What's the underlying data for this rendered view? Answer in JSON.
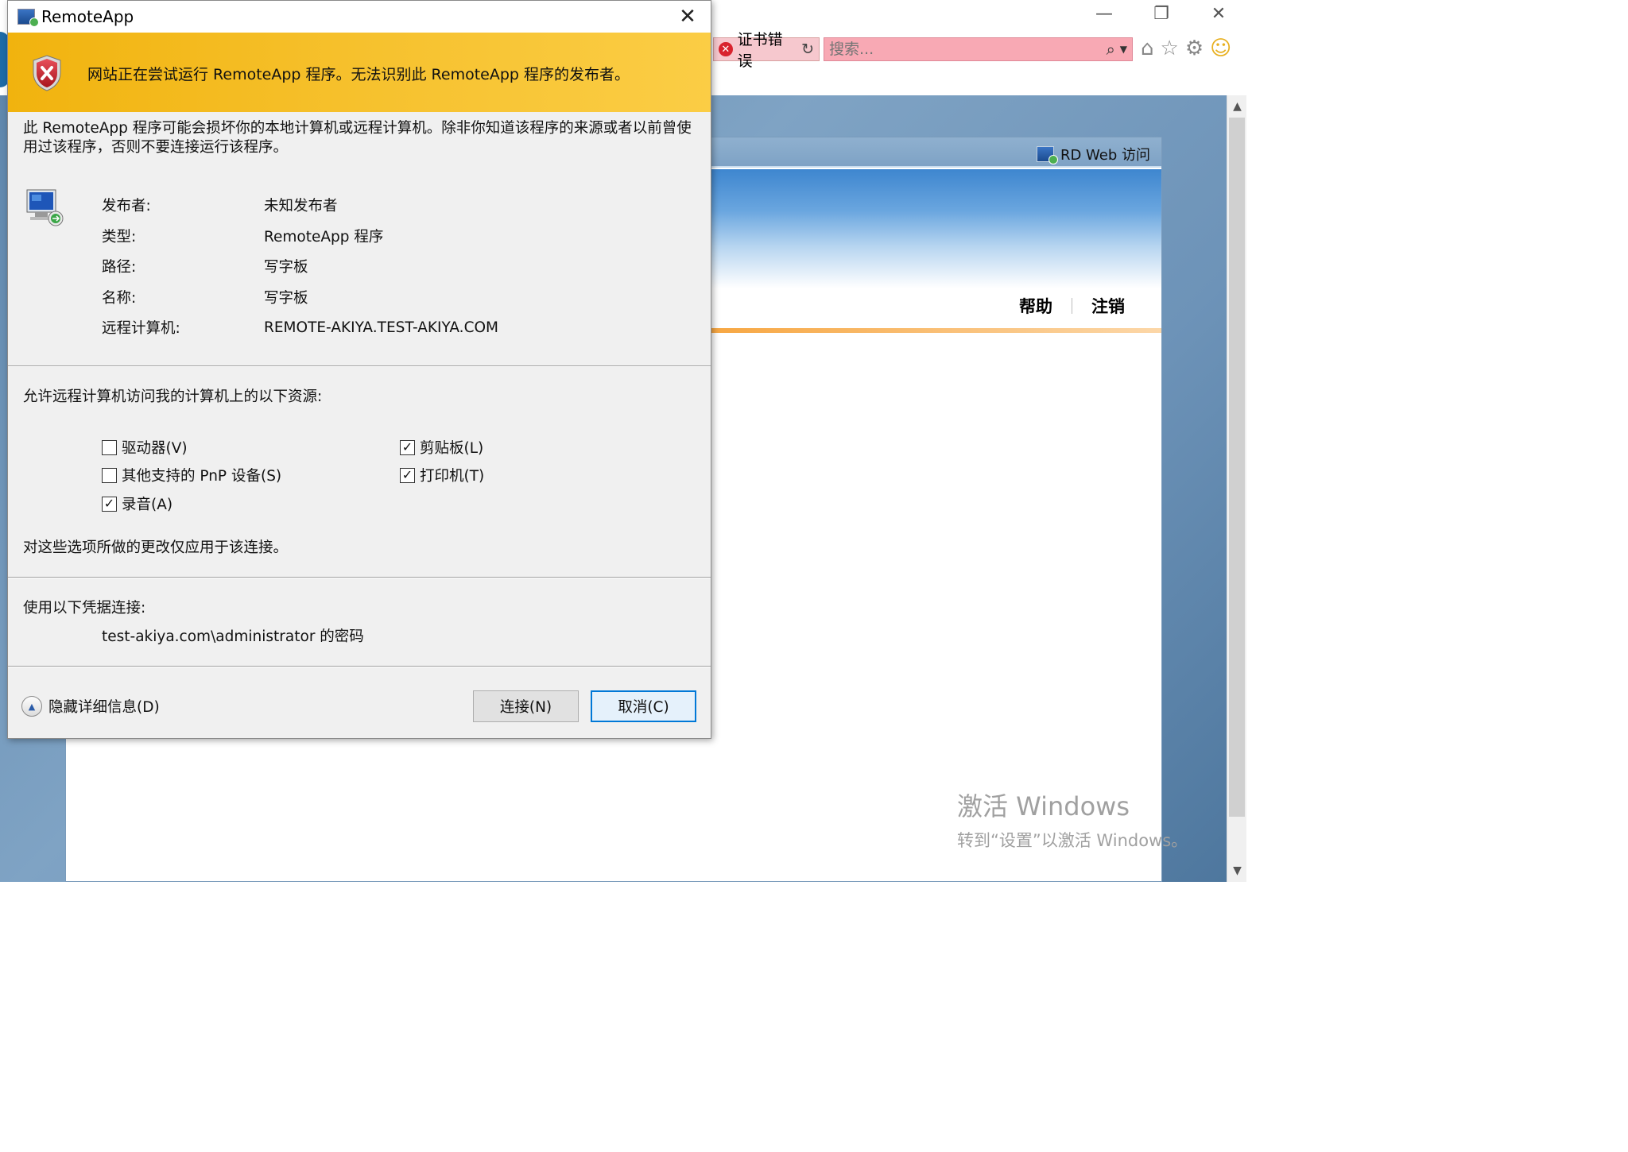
{
  "browser": {
    "window_controls": {
      "minimize": "—",
      "restore": "❐",
      "close": "✕"
    },
    "cert_error": "证书错误",
    "search": {
      "placeholder": "搜索..."
    },
    "toolbar_icons": [
      "home-icon",
      "favorites-star-icon",
      "gear-icon",
      "smiley-icon"
    ]
  },
  "rdweb": {
    "title": "RD Web 访问",
    "nav": {
      "help": "帮助",
      "logout": "注销"
    }
  },
  "watermark": {
    "line1": "激活 Windows",
    "line2": "转到“设置”以激活 Windows。"
  },
  "dialog": {
    "title": "RemoteApp",
    "warning": "网站正在尝试运行 RemoteApp 程序。无法识别此 RemoteApp 程序的发布者。",
    "intro": "此 RemoteApp 程序可能会损坏你的本地计算机或远程计算机。除非你知道该程序的来源或者以前曾使用过该程序，否则不要连接运行该程序。",
    "info": [
      {
        "label": "发布者:",
        "value": "未知发布者"
      },
      {
        "label": "类型:",
        "value": "RemoteApp 程序"
      },
      {
        "label": "路径:",
        "value": "写字板"
      },
      {
        "label": "名称:",
        "value": "写字板"
      },
      {
        "label": "远程计算机:",
        "value": "REMOTE-AKIYA.TEST-AKIYA.COM"
      }
    ],
    "resources_title": "允许远程计算机访问我的计算机上的以下资源:",
    "resources": {
      "drives": {
        "label": "驱动器(V)",
        "checked": false
      },
      "pnp": {
        "label": "其他支持的 PnP 设备(S)",
        "checked": false
      },
      "audio": {
        "label": "录音(A)",
        "checked": true
      },
      "clipboard": {
        "label": "剪贴板(L)",
        "checked": true
      },
      "printer": {
        "label": "打印机(T)",
        "checked": true
      }
    },
    "note": "对这些选项所做的更改仅应用于该连接。",
    "credentials_title": "使用以下凭据连接:",
    "credentials_value": "test-akiya.com\\administrator 的密码",
    "hide_details": "隐藏详细信息(D)",
    "connect_button": "连接(N)",
    "cancel_button": "取消(C)"
  },
  "colors": {
    "warning_band": "#f6c12d",
    "cert_error_bg": "#f6c8ce",
    "search_bg": "#f8a9b4",
    "accent_blue": "#0078d7",
    "orange_line": "#f39a33"
  }
}
